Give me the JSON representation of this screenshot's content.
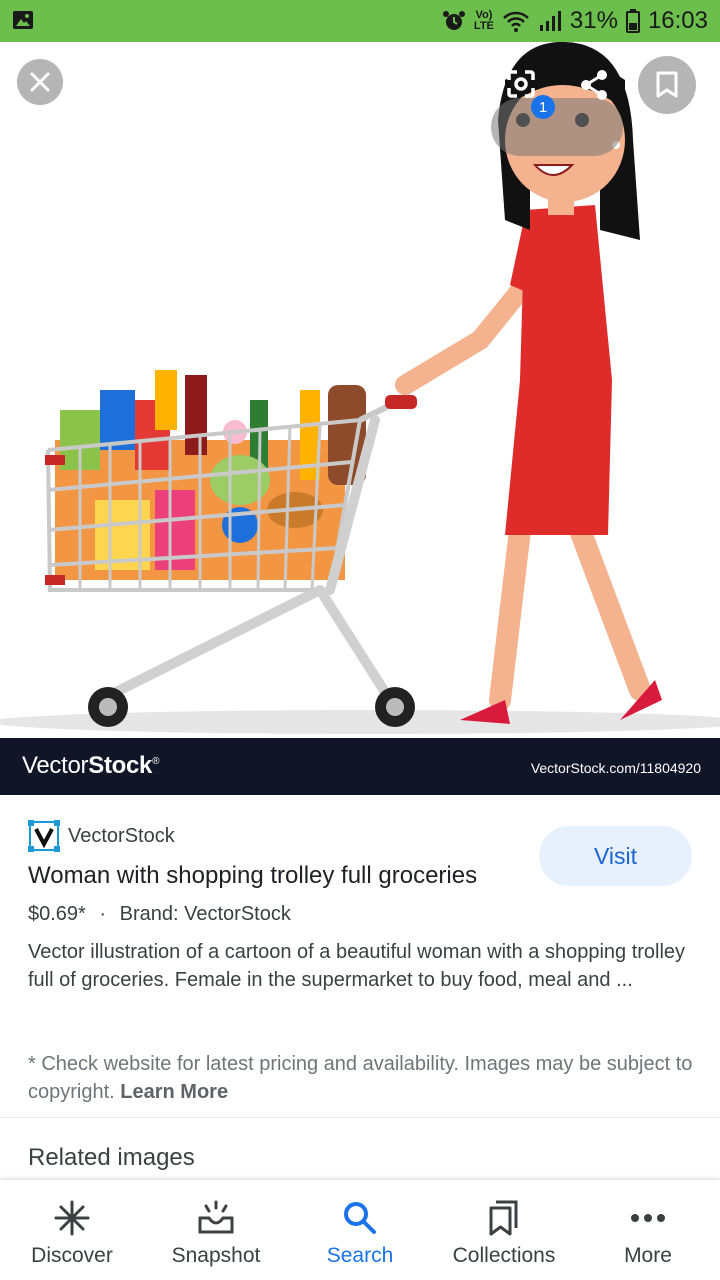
{
  "status_bar": {
    "lte_top": "Vo)",
    "lte_bottom": "LTE",
    "battery": "31%",
    "time": "16:03"
  },
  "viewer": {
    "badge_count": "1",
    "watermark_brand_light": "Vector",
    "watermark_brand_bold": "Stock",
    "watermark_reg": "®",
    "watermark_url": "VectorStock.com/11804920"
  },
  "result": {
    "source": "VectorStock",
    "title": "Woman with shopping trolley full groceries",
    "visit_label": "Visit",
    "price": "$0.69*",
    "separator": "·",
    "brand": "Brand: VectorStock",
    "description": "Vector illustration of a cartoon of a beautiful woman with a shopping trolley full of groceries. Female in the supermarket to buy food, meal and ...",
    "disclaimer": "* Check website for latest pricing and availability. Images may be subject to copyright.",
    "learn_more": "Learn More"
  },
  "related_heading": "Related images",
  "bottom_nav": {
    "discover": "Discover",
    "snapshot": "Snapshot",
    "search": "Search",
    "collections": "Collections",
    "more": "More"
  },
  "colors": {
    "status_bar": "#6cbf4c",
    "accent": "#1a73e8",
    "banner": "#101628",
    "dress": "#e02b2b"
  }
}
